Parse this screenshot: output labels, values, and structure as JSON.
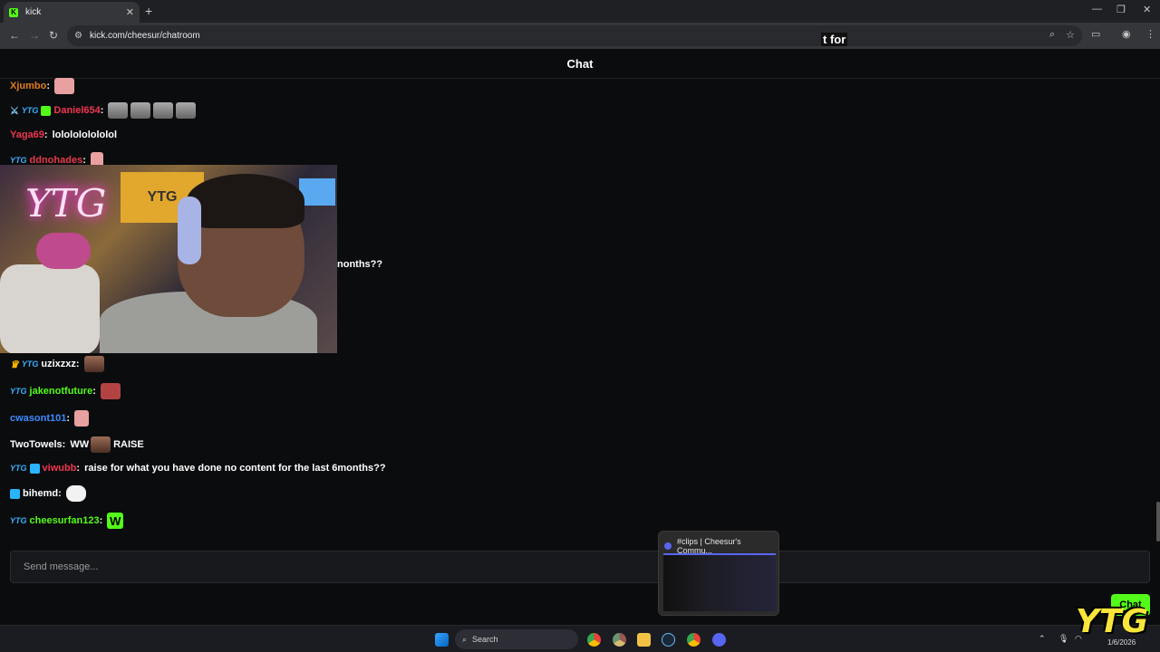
{
  "browser": {
    "tab_title": "kick",
    "tab_favicon": "K",
    "url": "kick.com/cheesur/chatroom",
    "overlay_text": "t for"
  },
  "chat": {
    "header": "Chat",
    "messages": [
      {
        "user": "Xjumbo",
        "color": "#e07b1f",
        "text": ""
      },
      {
        "user": "Daniel654",
        "color": "#f0364f",
        "text": ""
      },
      {
        "user": "Yaga69",
        "color": "#f0364f",
        "text": "lololololololol"
      },
      {
        "user": "ddnohades",
        "color": "#e53c4b",
        "text": ""
      },
      {
        "user": "uzixzxz",
        "color": "#ffffff",
        "text": ""
      },
      {
        "user": "jakenotfuture",
        "color": "#53fc18",
        "text": ""
      },
      {
        "user": "cwasont101",
        "color": "#3a8cff",
        "text": ""
      },
      {
        "user": "TwoTowels",
        "color": "#ffffff",
        "text_before": "WW",
        "text_after": "RAISE"
      },
      {
        "user": "viwubb",
        "color": "#f0364f",
        "text": "raise for what you have done no content for the last 6months??"
      },
      {
        "user": "bihemd",
        "color": "#ffffff",
        "text": ""
      },
      {
        "user": "cheesurfan123",
        "color": "#53fc18",
        "text": ""
      }
    ],
    "cut_text": "nonths??",
    "input_placeholder": "Send message...",
    "send_button": "Chat"
  },
  "webcam": {
    "neon_sign": "YTG",
    "banner": "YTG"
  },
  "preview": {
    "title": "#clips | Cheesur's Commu..."
  },
  "taskbar": {
    "search_label": "Search",
    "date": "1/6/2026"
  },
  "watermark": "YTG"
}
